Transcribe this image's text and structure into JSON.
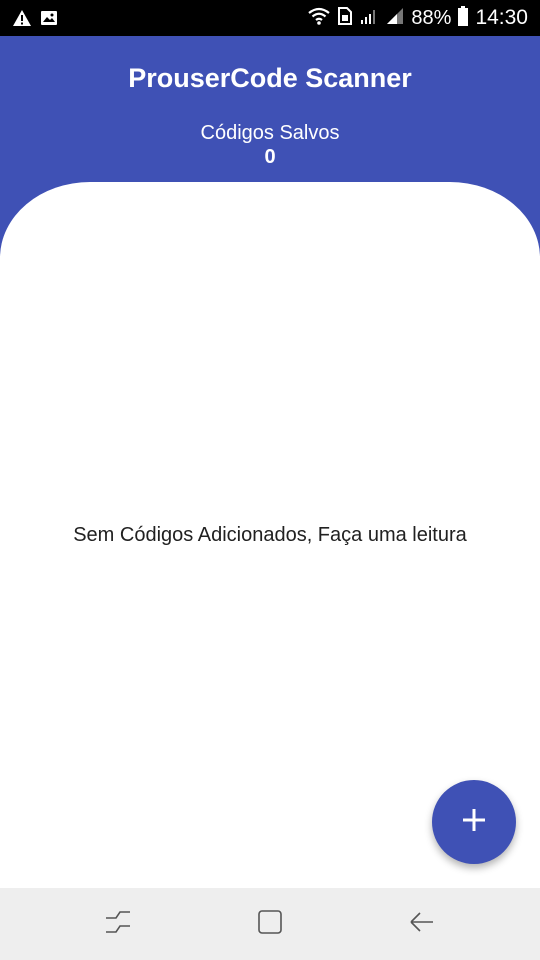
{
  "status_bar": {
    "battery_percent": "88%",
    "time": "14:30",
    "icons": [
      "warning-icon",
      "image-icon",
      "wifi-icon",
      "sim-icon",
      "signal-icon",
      "signal-icon",
      "battery-icon"
    ]
  },
  "header": {
    "title": "ProuserCode Scanner",
    "saved_label": "Códigos Salvos",
    "saved_count": "0"
  },
  "main": {
    "empty_message": "Sem Códigos Adicionados, Faça uma leitura"
  },
  "fab": {
    "icon": "add-icon"
  },
  "nav_bar": {
    "buttons": [
      "recent-apps-icon",
      "home-icon",
      "back-icon"
    ]
  },
  "colors": {
    "primary": "#3f51b5",
    "status_bar": "#000000",
    "nav_bar": "#eeeeee"
  }
}
